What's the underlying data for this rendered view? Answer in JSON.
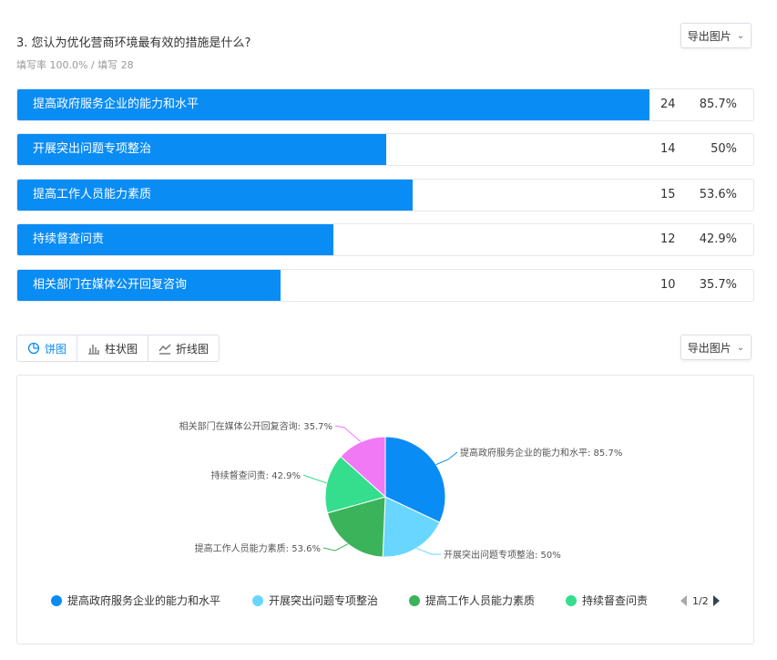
{
  "question": {
    "title": "3. 您认为优化营商环境最有效的措施是什么?",
    "fill_rate": "填写率 100.0% / 填写 28",
    "export_label": "导出图片"
  },
  "options": [
    {
      "label": "提高政府服务企业的能力和水平",
      "count": "24",
      "percent": "85.7%",
      "ratio": 0.857,
      "color": "#0a8cf5"
    },
    {
      "label": "开展突出问题专项整治",
      "count": "14",
      "percent": "50%",
      "ratio": 0.5,
      "color": "#69d6ff"
    },
    {
      "label": "提高工作人员能力素质",
      "count": "15",
      "percent": "53.6%",
      "ratio": 0.536,
      "color": "#3bb35a"
    },
    {
      "label": "持续督查问责",
      "count": "12",
      "percent": "42.9%",
      "ratio": 0.429,
      "color": "#34de8c"
    },
    {
      "label": "相关部门在媒体公开回复咨询",
      "count": "10",
      "percent": "35.7%",
      "ratio": 0.357,
      "color": "#f279f5"
    }
  ],
  "chart_tabs": {
    "pie": "饼图",
    "bar": "柱状图",
    "line": "折线图",
    "active": "pie",
    "export_label": "导出图片"
  },
  "chart_data": {
    "type": "pie",
    "slices": [
      {
        "name": "提高政府服务企业的能力和水平",
        "value": 24,
        "label": "提高政府服务企业的能力和水平: 85.7%"
      },
      {
        "name": "开展突出问题专项整治",
        "value": 14,
        "label": "开展突出问题专项整治: 50%"
      },
      {
        "name": "提高工作人员能力素质",
        "value": 15,
        "label": "提高工作人员能力素质: 53.6%"
      },
      {
        "name": "持续督查问责",
        "value": 12,
        "label": "持续督查问责: 42.9%"
      },
      {
        "name": "相关部门在媒体公开回复咨询",
        "value": 10,
        "label": "相关部门在媒体公开回复咨询: 35.7%"
      }
    ],
    "colors": [
      "#0a8cf5",
      "#69d6ff",
      "#3bb35a",
      "#34de8c",
      "#f279f5"
    ],
    "legend": [
      "提高政府服务企业的能力和水平",
      "开展突出问题专项整治",
      "提高工作人员能力素质",
      "持续督查问责"
    ],
    "legend_position": "bottom",
    "legend_page": "1/2"
  }
}
